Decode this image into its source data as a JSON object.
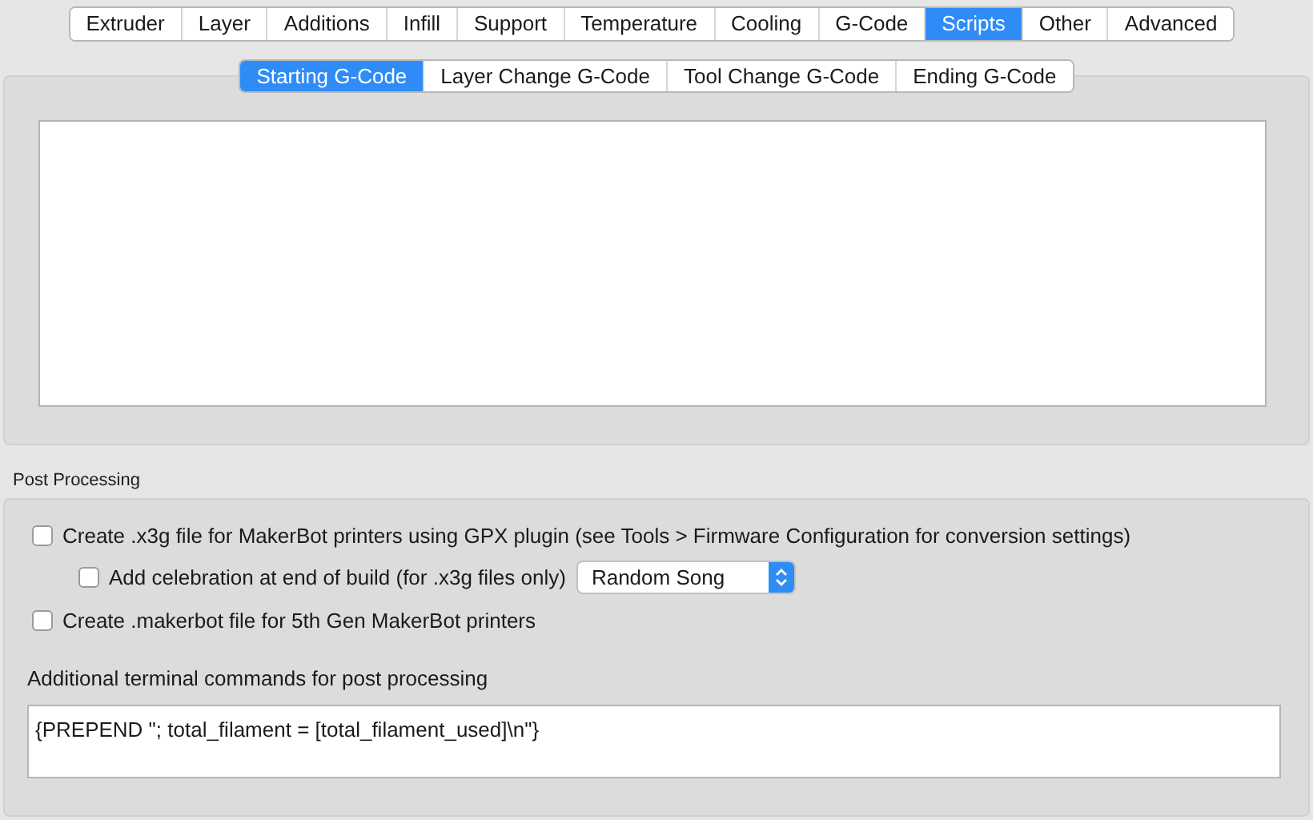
{
  "tabs": [
    {
      "label": "Extruder",
      "selected": false
    },
    {
      "label": "Layer",
      "selected": false
    },
    {
      "label": "Additions",
      "selected": false
    },
    {
      "label": "Infill",
      "selected": false
    },
    {
      "label": "Support",
      "selected": false
    },
    {
      "label": "Temperature",
      "selected": false
    },
    {
      "label": "Cooling",
      "selected": false
    },
    {
      "label": "G-Code",
      "selected": false
    },
    {
      "label": "Scripts",
      "selected": true
    },
    {
      "label": "Other",
      "selected": false
    },
    {
      "label": "Advanced",
      "selected": false
    }
  ],
  "script_tabs": [
    {
      "label": "Starting G-Code",
      "selected": true
    },
    {
      "label": "Layer Change G-Code",
      "selected": false
    },
    {
      "label": "Tool Change G-Code",
      "selected": false
    },
    {
      "label": "Ending G-Code",
      "selected": false
    }
  ],
  "post_processing": {
    "title": "Post Processing",
    "options": [
      {
        "kind": "checkbox",
        "label": "Create .x3g file for MakerBot printers using GPX plugin (see Tools > Firmware Configuration for conversion settings)",
        "checked": false
      },
      {
        "kind": "checkbox-select",
        "label": "Add celebration at end of build (for .x3g files only)",
        "checked": false,
        "value": "Random Song"
      },
      {
        "kind": "checkbox",
        "label": "Create .makerbot file for 5th Gen MakerBot printers",
        "checked": false
      }
    ],
    "commands_label": "Additional terminal commands for post processing",
    "commands_value": "{PREPEND \"; total_filament = [total_filament_used]\\n\"}"
  }
}
